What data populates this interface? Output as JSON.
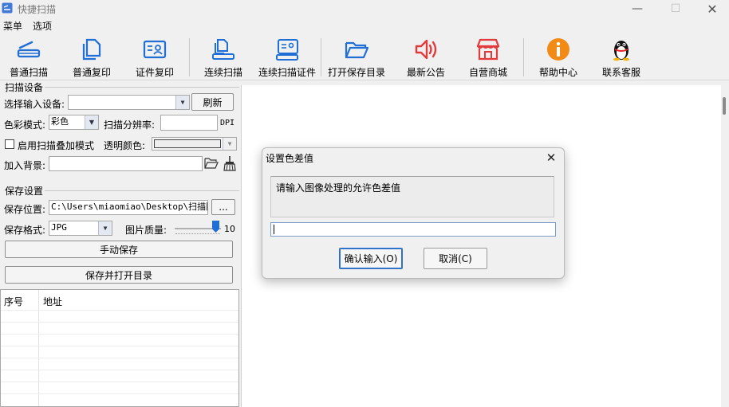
{
  "window": {
    "title": "快捷扫描"
  },
  "menu": [
    {
      "label": "菜单"
    },
    {
      "label": "选项"
    }
  ],
  "toolbar": {
    "items": [
      {
        "label": "普通扫描",
        "icon": "scanner-icon"
      },
      {
        "label": "普通复印",
        "icon": "copy-icon"
      },
      {
        "label": "证件复印",
        "icon": "id-card-icon"
      },
      {
        "label": "连续扫描",
        "icon": "continuous-scan-icon"
      },
      {
        "label": "连续扫描证件",
        "icon": "continuous-id-scan-icon"
      },
      {
        "label": "打开保存目录",
        "icon": "folder-open-icon"
      },
      {
        "label": "最新公告",
        "icon": "speaker-icon"
      },
      {
        "label": "自营商城",
        "icon": "shop-icon"
      },
      {
        "label": "帮助中心",
        "icon": "info-icon"
      },
      {
        "label": "联系客服",
        "icon": "qq-penguin-icon"
      }
    ]
  },
  "scan_settings": {
    "title": "扫描设备",
    "device_label": "选择输入设备:",
    "device_value": "",
    "refresh_label": "刷新",
    "color_mode_label": "色彩模式:",
    "color_mode_value": "彩色",
    "resolution_label": "扫描分辨率:",
    "resolution_value": "",
    "resolution_unit": "DPI",
    "overlay_label": "启用扫描叠加模式",
    "overlay_checked": false,
    "transparent_label": "透明颜色:",
    "background_label": "加入背景:",
    "background_value": ""
  },
  "save_settings": {
    "title": "保存设置",
    "location_label": "保存位置:",
    "location_value": "C:\\Users\\miaomiao\\Desktop\\扫描图片",
    "browse_label": "...",
    "format_label": "保存格式:",
    "format_value": "JPG",
    "quality_label": "图片质量:",
    "quality_value": "10",
    "manual_save_label": "手动保存",
    "save_open_label": "保存并打开目录"
  },
  "table": {
    "columns": [
      "序号",
      "地址"
    ]
  },
  "dialog": {
    "title": "设置色差值",
    "message": "请输入图像处理的允许色差值",
    "input_value": "",
    "confirm_label": "确认输入(O)",
    "cancel_label": "取消(C)"
  },
  "colors": {
    "accent": "#1f6fd6",
    "speaker_red": "#e33b3b",
    "info_orange": "#f28a16"
  }
}
